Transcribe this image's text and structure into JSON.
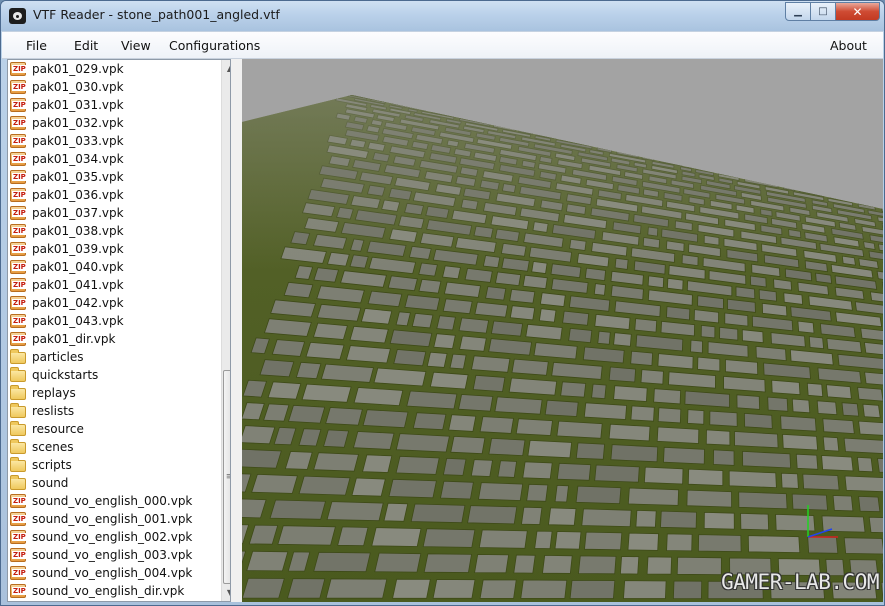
{
  "window": {
    "title": "VTF Reader - stone_path001_angled.vtf"
  },
  "menubar": {
    "items": [
      "File",
      "Edit",
      "View",
      "Configurations"
    ],
    "about": "About"
  },
  "file_tree": {
    "items": [
      {
        "label": "pak01_029.vpk",
        "icon": "zip-icon"
      },
      {
        "label": "pak01_030.vpk",
        "icon": "zip-icon"
      },
      {
        "label": "pak01_031.vpk",
        "icon": "zip-icon"
      },
      {
        "label": "pak01_032.vpk",
        "icon": "zip-icon"
      },
      {
        "label": "pak01_033.vpk",
        "icon": "zip-icon"
      },
      {
        "label": "pak01_034.vpk",
        "icon": "zip-icon"
      },
      {
        "label": "pak01_035.vpk",
        "icon": "zip-icon"
      },
      {
        "label": "pak01_036.vpk",
        "icon": "zip-icon"
      },
      {
        "label": "pak01_037.vpk",
        "icon": "zip-icon"
      },
      {
        "label": "pak01_038.vpk",
        "icon": "zip-icon"
      },
      {
        "label": "pak01_039.vpk",
        "icon": "zip-icon"
      },
      {
        "label": "pak01_040.vpk",
        "icon": "zip-icon"
      },
      {
        "label": "pak01_041.vpk",
        "icon": "zip-icon"
      },
      {
        "label": "pak01_042.vpk",
        "icon": "zip-icon"
      },
      {
        "label": "pak01_043.vpk",
        "icon": "zip-icon"
      },
      {
        "label": "pak01_dir.vpk",
        "icon": "zip-icon"
      },
      {
        "label": "particles",
        "icon": "folder-icon"
      },
      {
        "label": "quickstarts",
        "icon": "folder-icon"
      },
      {
        "label": "replays",
        "icon": "folder-icon"
      },
      {
        "label": "reslists",
        "icon": "folder-icon"
      },
      {
        "label": "resource",
        "icon": "folder-icon"
      },
      {
        "label": "scenes",
        "icon": "folder-icon"
      },
      {
        "label": "scripts",
        "icon": "folder-icon"
      },
      {
        "label": "sound",
        "icon": "folder-icon"
      },
      {
        "label": "sound_vo_english_000.vpk",
        "icon": "zip-icon"
      },
      {
        "label": "sound_vo_english_001.vpk",
        "icon": "zip-icon"
      },
      {
        "label": "sound_vo_english_002.vpk",
        "icon": "zip-icon"
      },
      {
        "label": "sound_vo_english_003.vpk",
        "icon": "zip-icon"
      },
      {
        "label": "sound_vo_english_004.vpk",
        "icon": "zip-icon"
      },
      {
        "label": "sound_vo_english_dir.vpk",
        "icon": "zip-icon"
      }
    ]
  },
  "viewport": {
    "description_icon": "axis-gizmo-icon",
    "watermark": "GAMER-LAB.COM"
  },
  "colors": {
    "sky": "#a3a3a3",
    "moss": "#5a6e24",
    "stone": "#7a7b70",
    "close_button": "#c9442c"
  }
}
